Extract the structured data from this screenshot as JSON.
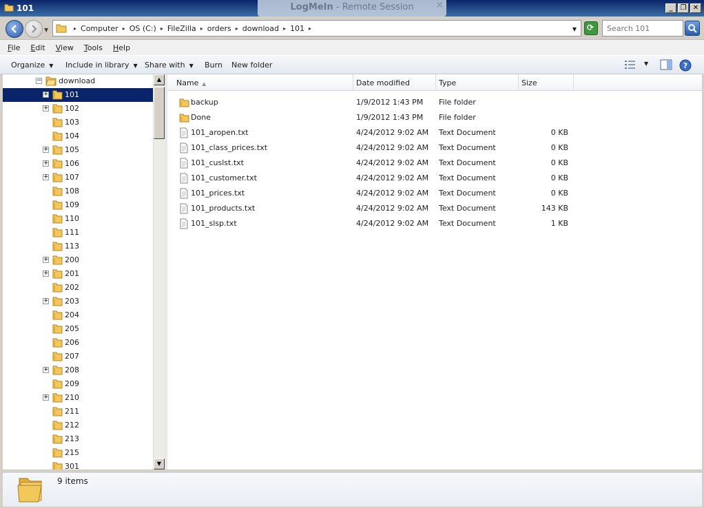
{
  "window": {
    "title": "101"
  },
  "logmein": {
    "brand": "LogMeIn",
    "suffix": " - Remote Session"
  },
  "address": {
    "crumbs": [
      "Computer",
      "OS (C:)",
      "FileZilla",
      "orders",
      "download",
      "101"
    ]
  },
  "search": {
    "placeholder": "Search 101"
  },
  "menu": {
    "items": [
      "File",
      "Edit",
      "View",
      "Tools",
      "Help"
    ]
  },
  "toolbar": {
    "organize": "Organize",
    "include": "Include in library",
    "share": "Share with",
    "burn": "Burn",
    "new_folder": "New folder"
  },
  "tree": {
    "parent": "download",
    "items": [
      {
        "label": "101",
        "expandable": true,
        "selected": true
      },
      {
        "label": "102",
        "expandable": true
      },
      {
        "label": "103",
        "expandable": false
      },
      {
        "label": "104",
        "expandable": false
      },
      {
        "label": "105",
        "expandable": true
      },
      {
        "label": "106",
        "expandable": true
      },
      {
        "label": "107",
        "expandable": true
      },
      {
        "label": "108",
        "expandable": false
      },
      {
        "label": "109",
        "expandable": false
      },
      {
        "label": "110",
        "expandable": false
      },
      {
        "label": "111",
        "expandable": false
      },
      {
        "label": "113",
        "expandable": false
      },
      {
        "label": "200",
        "expandable": true
      },
      {
        "label": "201",
        "expandable": true
      },
      {
        "label": "202",
        "expandable": false
      },
      {
        "label": "203",
        "expandable": true
      },
      {
        "label": "204",
        "expandable": false
      },
      {
        "label": "205",
        "expandable": false
      },
      {
        "label": "206",
        "expandable": false
      },
      {
        "label": "207",
        "expandable": false
      },
      {
        "label": "208",
        "expandable": true
      },
      {
        "label": "209",
        "expandable": false
      },
      {
        "label": "210",
        "expandable": true
      },
      {
        "label": "211",
        "expandable": false
      },
      {
        "label": "212",
        "expandable": false
      },
      {
        "label": "213",
        "expandable": false
      },
      {
        "label": "215",
        "expandable": false
      },
      {
        "label": "301",
        "expandable": false
      }
    ]
  },
  "columns": {
    "name": "Name",
    "date": "Date modified",
    "type": "Type",
    "size": "Size"
  },
  "files": [
    {
      "name": "backup",
      "date": "1/9/2012 1:43 PM",
      "type": "File folder",
      "size": "",
      "kind": "folder"
    },
    {
      "name": "Done",
      "date": "1/9/2012 1:43 PM",
      "type": "File folder",
      "size": "",
      "kind": "folder"
    },
    {
      "name": "101_aropen.txt",
      "date": "4/24/2012 9:02 AM",
      "type": "Text Document",
      "size": "0 KB",
      "kind": "text"
    },
    {
      "name": "101_class_prices.txt",
      "date": "4/24/2012 9:02 AM",
      "type": "Text Document",
      "size": "0 KB",
      "kind": "text"
    },
    {
      "name": "101_cuslst.txt",
      "date": "4/24/2012 9:02 AM",
      "type": "Text Document",
      "size": "0 KB",
      "kind": "text"
    },
    {
      "name": "101_customer.txt",
      "date": "4/24/2012 9:02 AM",
      "type": "Text Document",
      "size": "0 KB",
      "kind": "text"
    },
    {
      "name": "101_prices.txt",
      "date": "4/24/2012 9:02 AM",
      "type": "Text Document",
      "size": "0 KB",
      "kind": "text"
    },
    {
      "name": "101_products.txt",
      "date": "4/24/2012 9:02 AM",
      "type": "Text Document",
      "size": "143 KB",
      "kind": "text"
    },
    {
      "name": "101_slsp.txt",
      "date": "4/24/2012 9:02 AM",
      "type": "Text Document",
      "size": "1 KB",
      "kind": "text"
    }
  ],
  "status": {
    "count": "9 items"
  },
  "colors": {
    "selection": "#0a246a",
    "folder": "#e8b84a",
    "titlebar": "#0a246a"
  }
}
